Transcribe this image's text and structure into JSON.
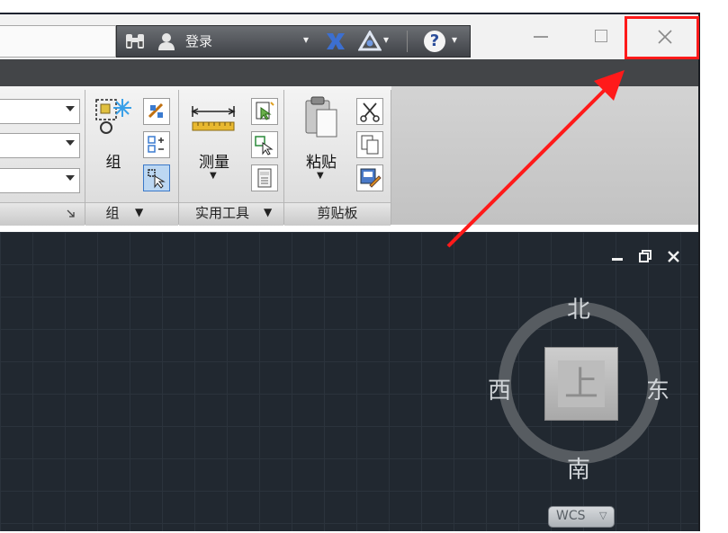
{
  "titlebar": {
    "login_label": "登录",
    "help_label": "?"
  },
  "ribbon": {
    "group_button_label": "组",
    "measure_button_label": "测量",
    "paste_button_label": "粘贴",
    "panels": [
      {
        "title": "组"
      },
      {
        "title": "实用工具"
      },
      {
        "title": "剪贴板"
      }
    ]
  },
  "viewcube": {
    "north": "北",
    "south": "南",
    "east": "东",
    "west": "西",
    "top_face": "上",
    "wcs_label": "WCS"
  },
  "colors": {
    "highlight": "#ff1a1a",
    "canvas": "#212830"
  }
}
